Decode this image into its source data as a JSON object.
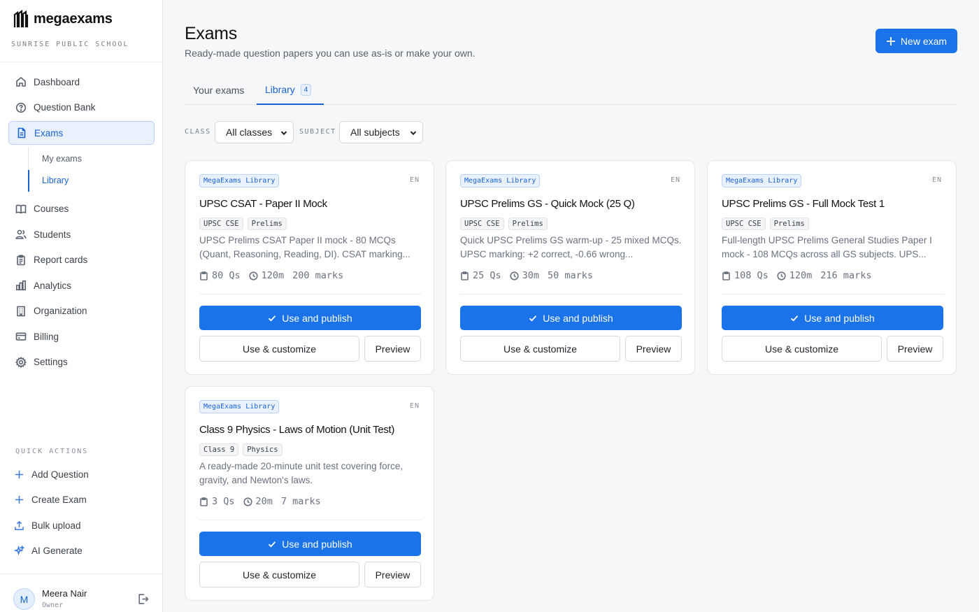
{
  "brand": {
    "name": "megaexams",
    "school": "SUNRISE PUBLIC SCHOOL"
  },
  "sidebar": {
    "items": [
      {
        "label": "Dashboard",
        "icon": "home-icon"
      },
      {
        "label": "Question Bank",
        "icon": "question-circle-icon"
      },
      {
        "label": "Exams",
        "icon": "document-icon",
        "active": true
      },
      {
        "label": "Courses",
        "icon": "book-icon"
      },
      {
        "label": "Students",
        "icon": "users-icon"
      },
      {
        "label": "Report cards",
        "icon": "clipboard-icon"
      },
      {
        "label": "Analytics",
        "icon": "bar-chart-icon"
      },
      {
        "label": "Organization",
        "icon": "building-icon"
      },
      {
        "label": "Billing",
        "icon": "credit-card-icon"
      },
      {
        "label": "Settings",
        "icon": "gear-icon"
      }
    ],
    "exams_sub": [
      {
        "label": "My exams"
      },
      {
        "label": "Library",
        "active": true
      }
    ],
    "quick_actions_title": "QUICK ACTIONS",
    "quick_actions": [
      {
        "label": "Add Question",
        "icon": "plus-icon"
      },
      {
        "label": "Create Exam",
        "icon": "plus-icon"
      },
      {
        "label": "Bulk upload",
        "icon": "upload-icon"
      },
      {
        "label": "AI Generate",
        "icon": "sparkle-icon"
      }
    ],
    "user": {
      "initial": "M",
      "name": "Meera Nair",
      "role": "Owner"
    }
  },
  "header": {
    "title": "Exams",
    "subtitle": "Ready-made question papers you can use as-is or make your own.",
    "new_button": "New exam"
  },
  "tabs": [
    {
      "label": "Your exams"
    },
    {
      "label": "Library",
      "count": "4",
      "active": true
    }
  ],
  "filters": {
    "class_label": "CLASS",
    "class_value": "All classes",
    "subject_label": "SUBJECT",
    "subject_value": "All subjects"
  },
  "actions": {
    "publish": "Use and publish",
    "customize": "Use & customize",
    "preview": "Preview"
  },
  "cards": [
    {
      "source": "MegaExams Library",
      "lang": "EN",
      "title": "UPSC CSAT - Paper II Mock",
      "tags": [
        "UPSC CSE",
        "Prelims"
      ],
      "description": "UPSC Prelims CSAT Paper II mock - 80 MCQs (Quant, Reasoning, Reading, DI). CSAT marking...",
      "questions": "80 Qs",
      "duration": "120m",
      "marks": "200 marks"
    },
    {
      "source": "MegaExams Library",
      "lang": "EN",
      "title": "UPSC Prelims GS - Quick Mock (25 Q)",
      "tags": [
        "UPSC CSE",
        "Prelims"
      ],
      "description": "Quick UPSC Prelims GS warm-up - 25 mixed MCQs. UPSC marking: +2 correct, -0.66 wrong...",
      "questions": "25 Qs",
      "duration": "30m",
      "marks": "50 marks"
    },
    {
      "source": "MegaExams Library",
      "lang": "EN",
      "title": "UPSC Prelims GS - Full Mock Test 1",
      "tags": [
        "UPSC CSE",
        "Prelims"
      ],
      "description": "Full-length UPSC Prelims General Studies Paper I mock - 108 MCQs across all GS subjects. UPS...",
      "questions": "108 Qs",
      "duration": "120m",
      "marks": "216 marks"
    },
    {
      "source": "MegaExams Library",
      "lang": "EN",
      "title": "Class 9 Physics - Laws of Motion (Unit Test)",
      "tags": [
        "Class 9",
        "Physics"
      ],
      "description": "A ready-made 20-minute unit test covering force, gravity, and Newton's laws.",
      "questions": "3 Qs",
      "duration": "20m",
      "marks": "7 marks"
    }
  ],
  "colors": {
    "accent": "#1a73e8",
    "accent_soft": "#e8f1fd",
    "background": "#f6f7f9"
  }
}
